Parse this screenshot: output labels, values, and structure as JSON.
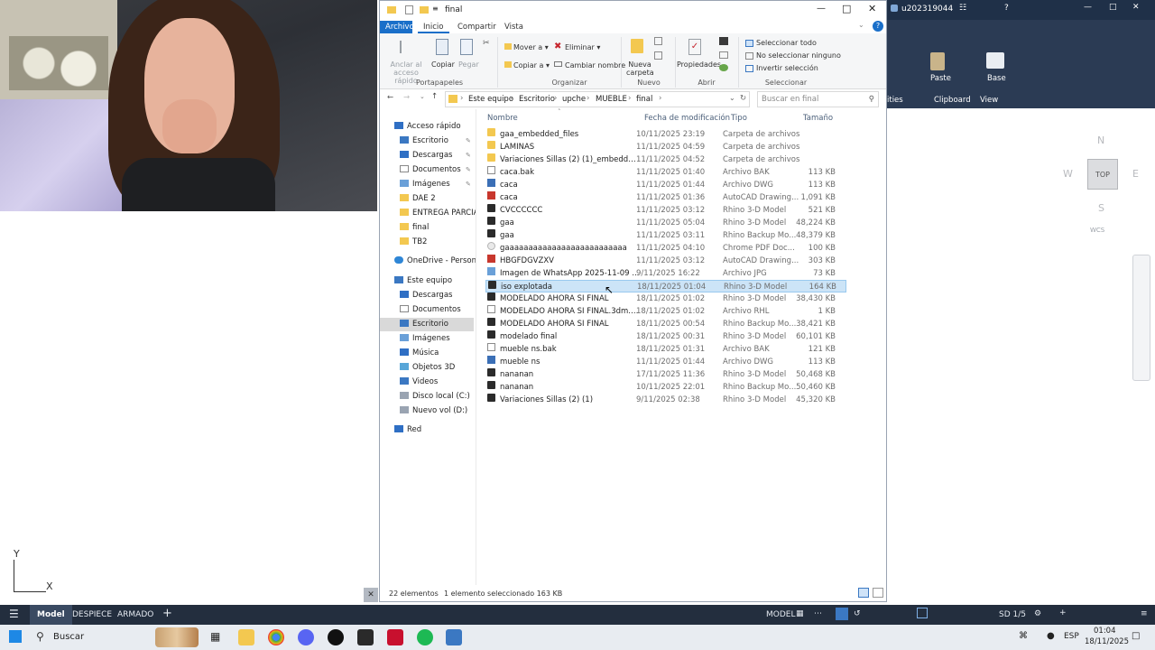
{
  "cad": {
    "user": "u202319044",
    "ribbon": {
      "paste": "Paste",
      "base": "Base",
      "clipboard": "Clipboard",
      "view": "View",
      "utilities": "ities"
    },
    "viewcube": {
      "top": "TOP",
      "n": "N",
      "w": "W",
      "e": "E",
      "s": "S",
      "wcs": "WCS"
    },
    "ucs": {
      "y": "Y",
      "x": "X"
    },
    "tabs": [
      "Model",
      "DESPIECE",
      "ARMADO"
    ],
    "status": {
      "model": "MODEL",
      "scale": "SD 1/5"
    }
  },
  "explorer": {
    "title": "final",
    "tabs": {
      "archivo": "Archivo",
      "inicio": "Inicio",
      "compartir": "Compartir",
      "vista": "Vista"
    },
    "ribbon": {
      "anclar": "Anclar al acceso rápido",
      "copiar": "Copiar",
      "pegar": "Pegar",
      "portapapeles": "Portapapeles",
      "mover": "Mover a",
      "eliminar": "Eliminar",
      "copiar_a": "Copiar a",
      "cambiar_nombre": "Cambiar nombre",
      "organizar": "Organizar",
      "nueva_carpeta": "Nueva carpeta",
      "nuevo": "Nuevo",
      "propiedades": "Propiedades",
      "abrir": "Abrir",
      "seleccionar_todo": "Seleccionar todo",
      "no_seleccionar": "No seleccionar ninguno",
      "invertir": "Invertir selección",
      "seleccionar": "Seleccionar"
    },
    "breadcrumb": [
      "Este equipo",
      "Escritorio",
      "upche",
      "MUEBLE",
      "final"
    ],
    "search_placeholder": "Buscar en final",
    "nav": {
      "acceso_rapido": "Acceso rápido",
      "quick": [
        "Escritorio",
        "Descargas",
        "Documentos",
        "Imágenes",
        "DAE 2",
        "ENTREGA PARCIAL",
        "final",
        "TB2"
      ],
      "onedrive": "OneDrive - Personal",
      "este_equipo": "Este equipo",
      "pc": [
        "Descargas",
        "Documentos",
        "Escritorio",
        "Imágenes",
        "Música",
        "Objetos 3D",
        "Videos",
        "Disco local (C:)",
        "Nuevo vol (D:)"
      ],
      "red": "Red"
    },
    "columns": {
      "name": "Nombre",
      "date": "Fecha de modificación",
      "type": "Tipo",
      "size": "Tamaño"
    },
    "files": [
      {
        "name": "gaa_embedded_files",
        "date": "10/11/2025 23:19",
        "type": "Carpeta de archivos",
        "size": "",
        "icon": "folder"
      },
      {
        "name": "LAMINAS",
        "date": "11/11/2025 04:59",
        "type": "Carpeta de archivos",
        "size": "",
        "icon": "folder"
      },
      {
        "name": "Variaciones Sillas (2) (1)_embedded_files",
        "date": "11/11/2025 04:52",
        "type": "Carpeta de archivos",
        "size": "",
        "icon": "folder"
      },
      {
        "name": "caca.bak",
        "date": "11/11/2025 01:40",
        "type": "Archivo BAK",
        "size": "113 KB",
        "icon": "doc"
      },
      {
        "name": "caca",
        "date": "11/11/2025 01:44",
        "type": "Archivo DWG",
        "size": "113 KB",
        "icon": "dwg"
      },
      {
        "name": "caca",
        "date": "11/11/2025 01:36",
        "type": "AutoCAD Drawing...",
        "size": "1,091 KB",
        "icon": "dwgr"
      },
      {
        "name": "CVCCCCCC",
        "date": "11/11/2025 03:12",
        "type": "Rhino 3-D Model",
        "size": "521 KB",
        "icon": "rhino"
      },
      {
        "name": "gaa",
        "date": "11/11/2025 05:04",
        "type": "Rhino 3-D Model",
        "size": "48,224 KB",
        "icon": "rhino"
      },
      {
        "name": "gaa",
        "date": "11/11/2025 03:11",
        "type": "Rhino Backup Mo...",
        "size": "48,379 KB",
        "icon": "rhino"
      },
      {
        "name": "gaaaaaaaaaaaaaaaaaaaaaaaaaa",
        "date": "11/11/2025 04:10",
        "type": "Chrome PDF Doc...",
        "size": "100 KB",
        "icon": "pdf"
      },
      {
        "name": "HBGFDGVZXV",
        "date": "11/11/2025 03:12",
        "type": "AutoCAD Drawing...",
        "size": "303 KB",
        "icon": "dwgr"
      },
      {
        "name": "Imagen de WhatsApp 2025-11-09 a las 15...",
        "date": "9/11/2025 16:22",
        "type": "Archivo JPG",
        "size": "73 KB",
        "icon": "img"
      },
      {
        "name": "iso explotada",
        "date": "18/11/2025 01:04",
        "type": "Rhino 3-D Model",
        "size": "164 KB",
        "icon": "rhino",
        "selected": true
      },
      {
        "name": "MODELADO AHORA SI FINAL",
        "date": "18/11/2025 01:02",
        "type": "Rhino 3-D Model",
        "size": "38,430 KB",
        "icon": "rhino"
      },
      {
        "name": "MODELADO AHORA SI FINAL.3dm.rhl",
        "date": "18/11/2025 01:02",
        "type": "Archivo RHL",
        "size": "1 KB",
        "icon": "doc"
      },
      {
        "name": "MODELADO AHORA SI FINAL",
        "date": "18/11/2025 00:54",
        "type": "Rhino Backup Mo...",
        "size": "38,421 KB",
        "icon": "rhino"
      },
      {
        "name": "modelado final",
        "date": "18/11/2025 00:31",
        "type": "Rhino 3-D Model",
        "size": "60,101 KB",
        "icon": "rhino"
      },
      {
        "name": "mueble ns.bak",
        "date": "18/11/2025 01:31",
        "type": "Archivo BAK",
        "size": "121 KB",
        "icon": "doc"
      },
      {
        "name": "mueble ns",
        "date": "11/11/2025 01:44",
        "type": "Archivo DWG",
        "size": "113 KB",
        "icon": "dwg"
      },
      {
        "name": "nananan",
        "date": "17/11/2025 11:36",
        "type": "Rhino 3-D Model",
        "size": "50,468 KB",
        "icon": "rhino"
      },
      {
        "name": "nananan",
        "date": "10/11/2025 22:01",
        "type": "Rhino Backup Mo...",
        "size": "50,460 KB",
        "icon": "rhino"
      },
      {
        "name": "Variaciones Sillas (2) (1)",
        "date": "9/11/2025 02:38",
        "type": "Rhino 3-D Model",
        "size": "45,320 KB",
        "icon": "rhino"
      }
    ],
    "status": {
      "count": "22 elementos",
      "selection": "1 elemento seleccionado 163 KB"
    }
  },
  "taskbar": {
    "search": "Buscar",
    "lang": "ESP",
    "time": "01:04",
    "date": "18/11/2025"
  }
}
